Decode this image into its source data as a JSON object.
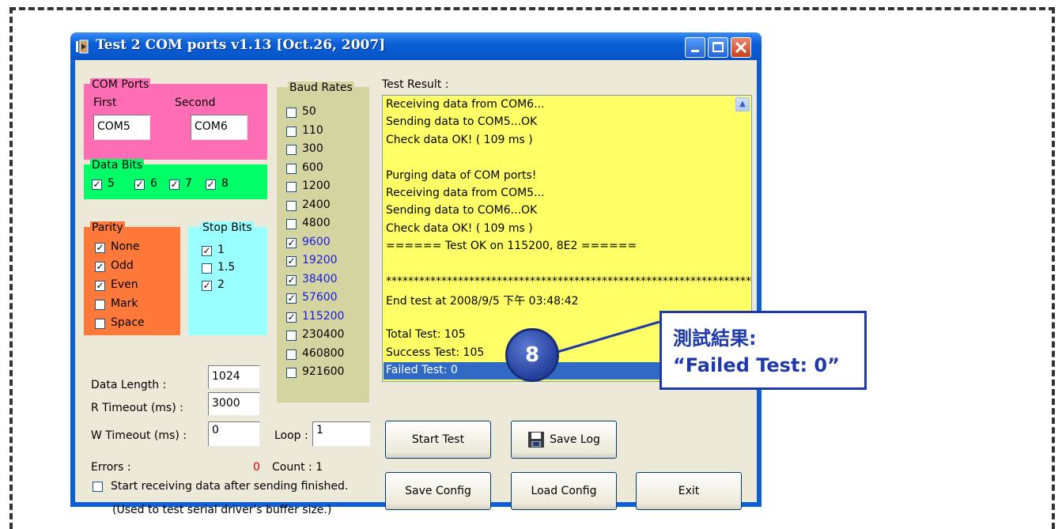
{
  "window": {
    "title": "Test 2 COM ports v1.13 [Oct.26, 2007]"
  },
  "com_ports": {
    "legend": "COM Ports",
    "first_label": "First",
    "second_label": "Second",
    "first_value": "COM5",
    "second_value": "COM6"
  },
  "data_bits": {
    "legend": "Data Bits",
    "items": [
      {
        "label": "5",
        "checked": true
      },
      {
        "label": "6",
        "checked": true
      },
      {
        "label": "7",
        "checked": true
      },
      {
        "label": "8",
        "checked": true
      }
    ]
  },
  "parity": {
    "legend": "Parity",
    "items": [
      {
        "label": "None",
        "checked": true
      },
      {
        "label": "Odd",
        "checked": true
      },
      {
        "label": "Even",
        "checked": true
      },
      {
        "label": "Mark",
        "checked": false
      },
      {
        "label": "Space",
        "checked": false
      }
    ]
  },
  "stop_bits": {
    "legend": "Stop Bits",
    "items": [
      {
        "label": "1",
        "checked": true
      },
      {
        "label": "1.5",
        "checked": false
      },
      {
        "label": "2",
        "checked": true
      }
    ]
  },
  "baud_rates": {
    "legend": "Baud Rates",
    "items": [
      {
        "label": "50",
        "checked": false
      },
      {
        "label": "110",
        "checked": false
      },
      {
        "label": "300",
        "checked": false
      },
      {
        "label": "600",
        "checked": false
      },
      {
        "label": "1200",
        "checked": false
      },
      {
        "label": "2400",
        "checked": false
      },
      {
        "label": "4800",
        "checked": false
      },
      {
        "label": "9600",
        "checked": true
      },
      {
        "label": "19200",
        "checked": true
      },
      {
        "label": "38400",
        "checked": true
      },
      {
        "label": "57600",
        "checked": true
      },
      {
        "label": "115200",
        "checked": true
      },
      {
        "label": "230400",
        "checked": false
      },
      {
        "label": "460800",
        "checked": false
      },
      {
        "label": "921600",
        "checked": false
      }
    ],
    "checked_color": "#1a1ae6"
  },
  "settings": {
    "data_length_label": "Data Length :",
    "data_length_value": "1024",
    "r_timeout_label": "R Timeout (ms) :",
    "r_timeout_value": "3000",
    "w_timeout_label": "W Timeout (ms) :",
    "w_timeout_value": "0",
    "loop_label": "Loop :",
    "loop_value": "1",
    "errors_label": "Errors :",
    "errors_value": "0",
    "errors_color": "#e00000",
    "count_label": "Count : 1",
    "start_receiving_label": "Start receiving data after sending finished.",
    "start_receiving_checked": false,
    "hint": "(Used to test serial driver's buffer size.)"
  },
  "test_result": {
    "label": "Test Result :",
    "lines": [
      "Receiving data from COM6...",
      "Sending data to COM5...OK",
      "Check data OK! ( 109 ms )",
      "",
      "Purging data of COM ports!",
      "Receiving data from COM5...",
      "Sending data to COM6...OK",
      "Check data OK! ( 109 ms )",
      "====== Test OK on 115200, 8E2 ======",
      "",
      "******************************************************************",
      "End test at 2008/9/5 下午 03:48:42",
      "",
      "Total Test: 105",
      "Success Test: 105",
      "Failed Test: 0"
    ],
    "selected_index": 15
  },
  "buttons": {
    "start_test": "Start Test",
    "save_log": "Save Log",
    "save_config": "Save Config",
    "load_config": "Load Config",
    "exit": "Exit"
  },
  "callout": {
    "badge": "8",
    "line1": "測試結果:",
    "line2": "“Failed Test: 0”"
  },
  "colors": {
    "com_ports_bg": "#ff6eb4",
    "data_bits_bg": "#00ff66",
    "parity_bg": "#ff7a3a",
    "stop_bits_bg": "#99ffff",
    "baud_bg": "#d4d4a0",
    "results_bg": "#ffff66",
    "titlebar": "#0a5fd6"
  }
}
